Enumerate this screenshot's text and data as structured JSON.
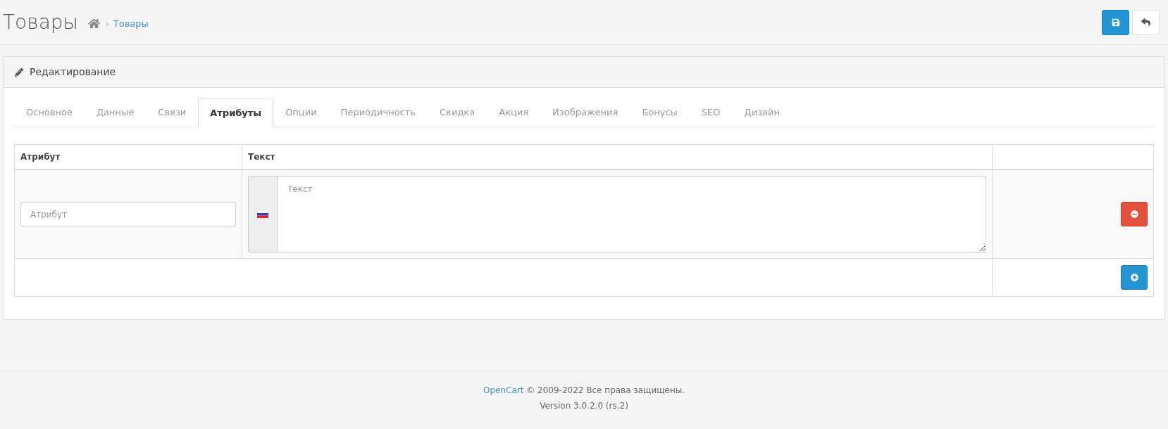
{
  "page_header": {
    "title": "Товары",
    "breadcrumb": [
      {
        "kind": "home"
      },
      {
        "kind": "link",
        "separator": "›",
        "label": "Товары"
      }
    ],
    "actions": [
      {
        "kind": "save"
      },
      {
        "kind": "back"
      }
    ]
  },
  "panel": {
    "heading": "Редактирование",
    "tabs": [
      {
        "label": "Основное",
        "selected": false
      },
      {
        "label": "Данные",
        "selected": false
      },
      {
        "label": "Связи",
        "selected": false
      },
      {
        "label": "Атрибуты",
        "selected": true
      },
      {
        "label": "Опции",
        "selected": false
      },
      {
        "label": "Периодичность",
        "selected": false
      },
      {
        "label": "Скидка",
        "selected": false
      },
      {
        "label": "Акция",
        "selected": false
      },
      {
        "label": "Изображения",
        "selected": false
      },
      {
        "label": "Бонусы",
        "selected": false
      },
      {
        "label": "SEO",
        "selected": false
      },
      {
        "label": "Дизайн",
        "selected": false
      }
    ],
    "table": {
      "columns": [
        "Атрибут",
        "Текст"
      ],
      "rows": [
        {
          "attribute_placeholder": "Атрибут",
          "text_placeholder": "Текст"
        }
      ]
    }
  },
  "footer": {
    "link": "OpenCart",
    "copyright": "© 2009-2022 Все права защищены.",
    "version": "Version 3.0.2.0 (rs.2)"
  }
}
